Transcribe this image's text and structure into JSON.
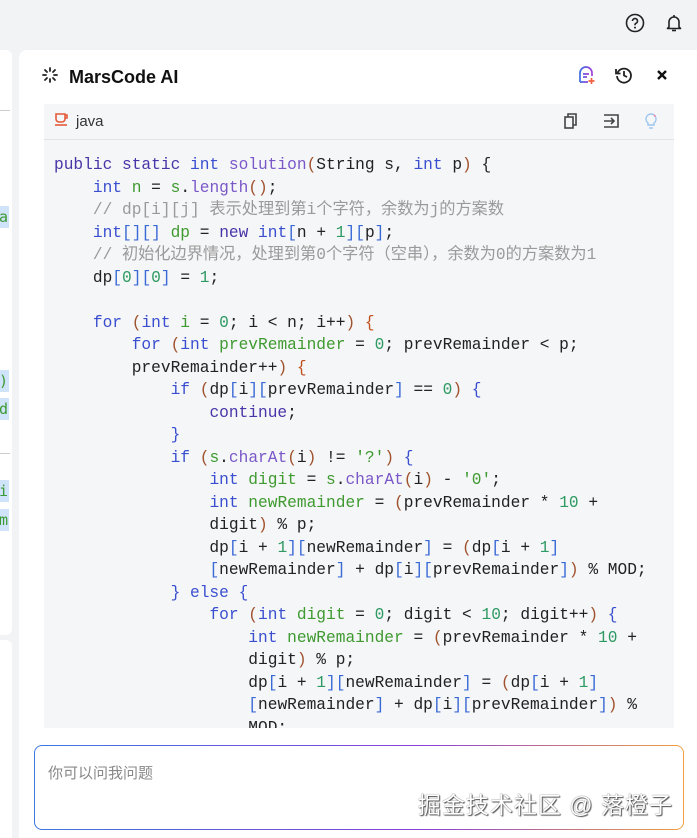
{
  "topbar": {
    "icons": [
      "help-icon",
      "bell-icon"
    ]
  },
  "left_fragments": [
    "a",
    ")",
    "d",
    "i",
    "m"
  ],
  "panel": {
    "title": "MarsCode AI",
    "icons": [
      "new-chat-icon",
      "history-icon",
      "close-icon"
    ]
  },
  "codeblock": {
    "language": "java",
    "icons": [
      "copy-icon",
      "insert-icon",
      "lightbulb-icon"
    ]
  },
  "code_lines": [
    [
      [
        "k",
        "public static "
      ],
      [
        "t",
        "int "
      ],
      [
        "f",
        "solution"
      ],
      [
        "p",
        "("
      ],
      [
        "",
        "String s, "
      ],
      [
        "t",
        "int "
      ],
      [
        "",
        "p"
      ],
      [
        "p",
        ")"
      ],
      [
        "",
        " {"
      ]
    ],
    [
      [
        "",
        "    "
      ],
      [
        "t",
        "int "
      ],
      [
        "v",
        "n"
      ],
      [
        "",
        " = "
      ],
      [
        "v",
        "s"
      ],
      [
        "",
        "."
      ],
      [
        "f",
        "length"
      ],
      [
        "p",
        "()"
      ],
      [
        "",
        ";"
      ]
    ],
    [
      [
        "c",
        "    // dp[i][j] 表示处理到第i个字符，余数为j的方案数"
      ]
    ],
    [
      [
        "",
        "    "
      ],
      [
        "t",
        "int"
      ],
      [
        "b",
        "[][]"
      ],
      [
        "",
        " "
      ],
      [
        "v",
        "dp"
      ],
      [
        "",
        " = "
      ],
      [
        "k",
        "new "
      ],
      [
        "t",
        "int"
      ],
      [
        "b",
        "["
      ],
      [
        "",
        "n + "
      ],
      [
        "n",
        "1"
      ],
      [
        "b",
        "]["
      ],
      [
        "",
        "p"
      ],
      [
        "b",
        "]"
      ],
      [
        "",
        ";"
      ]
    ],
    [
      [
        "c",
        "    // 初始化边界情况，处理到第0个字符（空串），余数为0的方案数为1"
      ]
    ],
    [
      [
        "",
        "    dp"
      ],
      [
        "b",
        "["
      ],
      [
        "n",
        "0"
      ],
      [
        "b",
        "]["
      ],
      [
        "n",
        "0"
      ],
      [
        "b",
        "]"
      ],
      [
        "",
        " = "
      ],
      [
        "n",
        "1"
      ],
      [
        "",
        ";"
      ]
    ],
    [
      [
        "",
        ""
      ]
    ],
    [
      [
        "",
        "    "
      ],
      [
        "t",
        "for "
      ],
      [
        "p",
        "("
      ],
      [
        "t",
        "int "
      ],
      [
        "v",
        "i"
      ],
      [
        "",
        " = "
      ],
      [
        "n",
        "0"
      ],
      [
        "",
        "; i < n; i++"
      ],
      [
        "p",
        ")"
      ],
      [
        "o",
        " {"
      ]
    ],
    [
      [
        "",
        "        "
      ],
      [
        "t",
        "for "
      ],
      [
        "p",
        "("
      ],
      [
        "t",
        "int "
      ],
      [
        "v",
        "prevRemainder"
      ],
      [
        "",
        " = "
      ],
      [
        "n",
        "0"
      ],
      [
        "",
        "; prevRemainder < p;"
      ]
    ],
    [
      [
        "",
        "        prevRemainder++"
      ],
      [
        "p",
        ")"
      ],
      [
        "o",
        " {"
      ]
    ],
    [
      [
        "",
        "            "
      ],
      [
        "t",
        "if "
      ],
      [
        "p",
        "("
      ],
      [
        "",
        "dp"
      ],
      [
        "b",
        "["
      ],
      [
        "",
        "i"
      ],
      [
        "b",
        "]["
      ],
      [
        "",
        "prevRemainder"
      ],
      [
        "b",
        "]"
      ],
      [
        "",
        " == "
      ],
      [
        "n",
        "0"
      ],
      [
        "p",
        ")"
      ],
      [
        "t",
        " {"
      ]
    ],
    [
      [
        "",
        "                "
      ],
      [
        "k",
        "continue"
      ],
      [
        "",
        ";"
      ]
    ],
    [
      [
        "",
        "            "
      ],
      [
        "t",
        "}"
      ]
    ],
    [
      [
        "",
        "            "
      ],
      [
        "t",
        "if "
      ],
      [
        "p",
        "("
      ],
      [
        "v",
        "s"
      ],
      [
        "",
        "."
      ],
      [
        "f",
        "charAt"
      ],
      [
        "p",
        "("
      ],
      [
        "",
        "i"
      ],
      [
        "p",
        ")"
      ],
      [
        "",
        " != "
      ],
      [
        "s",
        "'?'"
      ],
      [
        "p",
        ")"
      ],
      [
        "t",
        " {"
      ]
    ],
    [
      [
        "",
        "                "
      ],
      [
        "t",
        "int "
      ],
      [
        "v",
        "digit"
      ],
      [
        "",
        " = "
      ],
      [
        "v",
        "s"
      ],
      [
        "",
        "."
      ],
      [
        "f",
        "charAt"
      ],
      [
        "p",
        "("
      ],
      [
        "",
        "i"
      ],
      [
        "p",
        ")"
      ],
      [
        "",
        " - "
      ],
      [
        "s",
        "'0'"
      ],
      [
        "",
        ";"
      ]
    ],
    [
      [
        "",
        "                "
      ],
      [
        "t",
        "int "
      ],
      [
        "v",
        "newRemainder"
      ],
      [
        "",
        " = "
      ],
      [
        "p",
        "("
      ],
      [
        "",
        "prevRemainder * "
      ],
      [
        "n",
        "10"
      ],
      [
        "",
        " +"
      ]
    ],
    [
      [
        "",
        "                digit"
      ],
      [
        "p",
        ")"
      ],
      [
        "",
        " % p;"
      ]
    ],
    [
      [
        "",
        "                dp"
      ],
      [
        "b",
        "["
      ],
      [
        "",
        "i + "
      ],
      [
        "n",
        "1"
      ],
      [
        "b",
        "]["
      ],
      [
        "",
        "newRemainder"
      ],
      [
        "b",
        "]"
      ],
      [
        "",
        " = "
      ],
      [
        "p",
        "("
      ],
      [
        "",
        "dp"
      ],
      [
        "b",
        "["
      ],
      [
        "",
        "i + "
      ],
      [
        "n",
        "1"
      ],
      [
        "b",
        "]"
      ]
    ],
    [
      [
        "",
        "                "
      ],
      [
        "b",
        "["
      ],
      [
        "",
        "newRemainder"
      ],
      [
        "b",
        "]"
      ],
      [
        "",
        " + dp"
      ],
      [
        "b",
        "["
      ],
      [
        "",
        "i"
      ],
      [
        "b",
        "]["
      ],
      [
        "",
        "prevRemainder"
      ],
      [
        "b",
        "]"
      ],
      [
        "p",
        ")"
      ],
      [
        "",
        " % MOD;"
      ]
    ],
    [
      [
        "",
        "            "
      ],
      [
        "t",
        "} else {"
      ]
    ],
    [
      [
        "",
        "                "
      ],
      [
        "t",
        "for "
      ],
      [
        "p",
        "("
      ],
      [
        "t",
        "int "
      ],
      [
        "v",
        "digit"
      ],
      [
        "",
        " = "
      ],
      [
        "n",
        "0"
      ],
      [
        "",
        "; digit < "
      ],
      [
        "n",
        "10"
      ],
      [
        "",
        "; digit++"
      ],
      [
        "p",
        ")"
      ],
      [
        "t",
        " {"
      ]
    ],
    [
      [
        "",
        "                    "
      ],
      [
        "t",
        "int "
      ],
      [
        "v",
        "newRemainder"
      ],
      [
        "",
        " = "
      ],
      [
        "p",
        "("
      ],
      [
        "",
        "prevRemainder * "
      ],
      [
        "n",
        "10"
      ],
      [
        "",
        " +"
      ]
    ],
    [
      [
        "",
        "                    digit"
      ],
      [
        "p",
        ")"
      ],
      [
        "",
        " % p;"
      ]
    ],
    [
      [
        "",
        "                    dp"
      ],
      [
        "b",
        "["
      ],
      [
        "",
        "i + "
      ],
      [
        "n",
        "1"
      ],
      [
        "b",
        "]["
      ],
      [
        "",
        "newRemainder"
      ],
      [
        "b",
        "]"
      ],
      [
        "",
        " = "
      ],
      [
        "p",
        "("
      ],
      [
        "",
        "dp"
      ],
      [
        "b",
        "["
      ],
      [
        "",
        "i + "
      ],
      [
        "n",
        "1"
      ],
      [
        "b",
        "]"
      ]
    ],
    [
      [
        "",
        "                    "
      ],
      [
        "b",
        "["
      ],
      [
        "",
        "newRemainder"
      ],
      [
        "b",
        "]"
      ],
      [
        "",
        " + dp"
      ],
      [
        "b",
        "["
      ],
      [
        "",
        "i"
      ],
      [
        "b",
        "]["
      ],
      [
        "",
        "prevRemainder"
      ],
      [
        "b",
        "]"
      ],
      [
        "p",
        ")"
      ],
      [
        "",
        " %"
      ]
    ],
    [
      [
        "",
        "                    MOD;"
      ]
    ]
  ],
  "input": {
    "placeholder": "你可以问我问题"
  },
  "watermark": "掘金技术社区 @ 落橙子"
}
